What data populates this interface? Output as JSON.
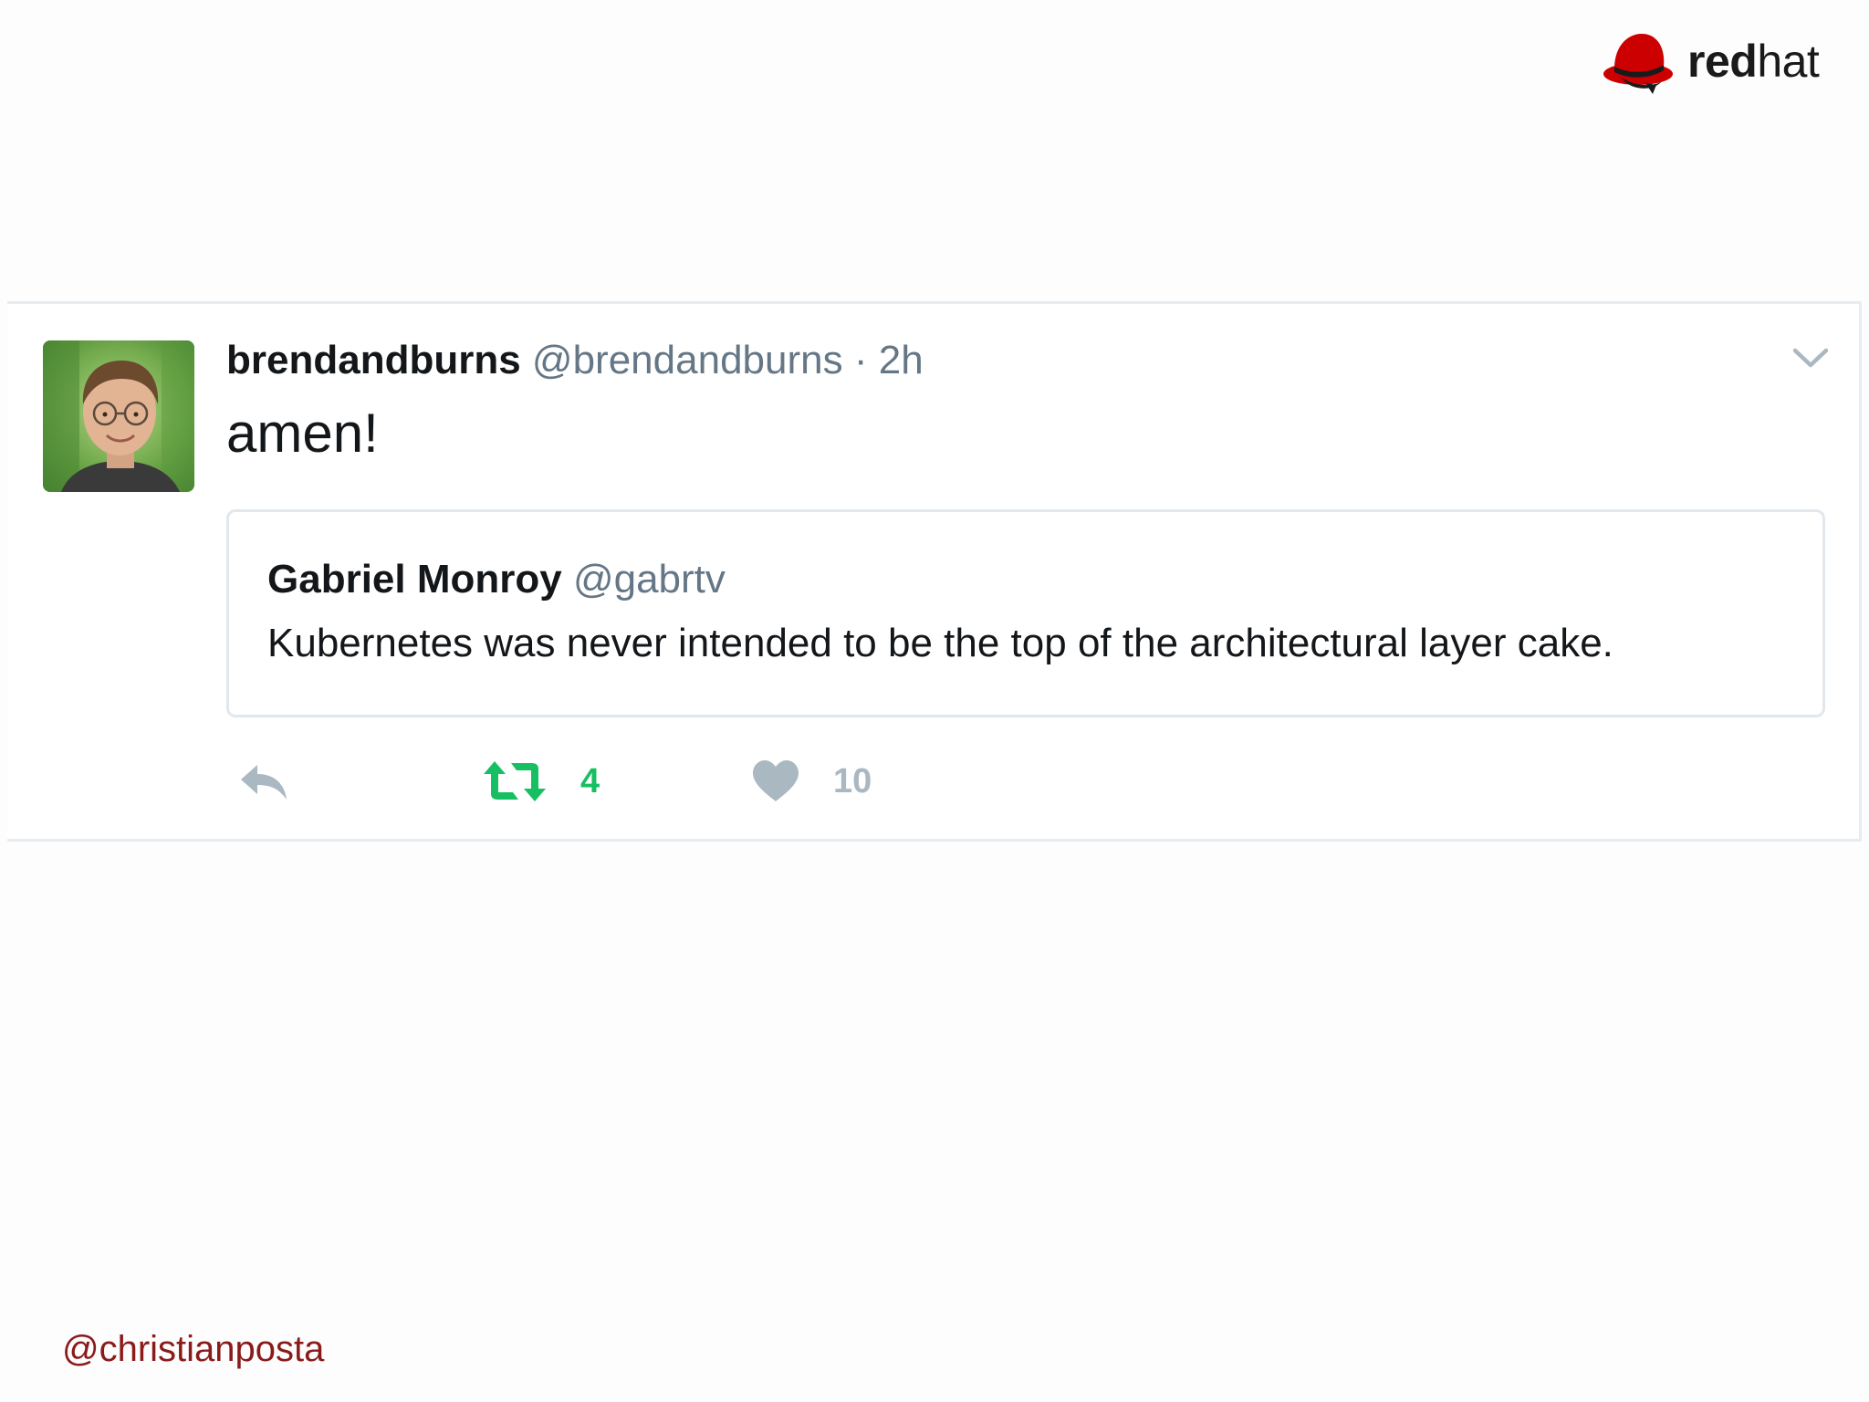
{
  "branding": {
    "logo_word_bold": "red",
    "logo_word_light": "hat",
    "logo_icon": "redhat-shadowman-icon"
  },
  "tweet": {
    "author_name": "brendandburns",
    "author_handle": "@brendandburns",
    "separator": "·",
    "time": "2h",
    "text": "amen!",
    "menu_icon": "chevron-down-icon",
    "quoted": {
      "author_name": "Gabriel Monroy",
      "author_handle": "@gabrtv",
      "text": "Kubernetes was never intended to be the top of the architectural layer cake."
    },
    "actions": {
      "reply_icon": "reply-icon",
      "retweet_icon": "retweet-icon",
      "retweet_count": "4",
      "like_icon": "heart-icon",
      "like_count": "10"
    }
  },
  "footer": {
    "handle": "@christianposta"
  },
  "colors": {
    "brand_red": "#cc0000",
    "retweet_green": "#17bf63",
    "muted_gray": "#657786",
    "icon_gray": "#aab8c2",
    "footer_text": "#8b1a1a"
  }
}
